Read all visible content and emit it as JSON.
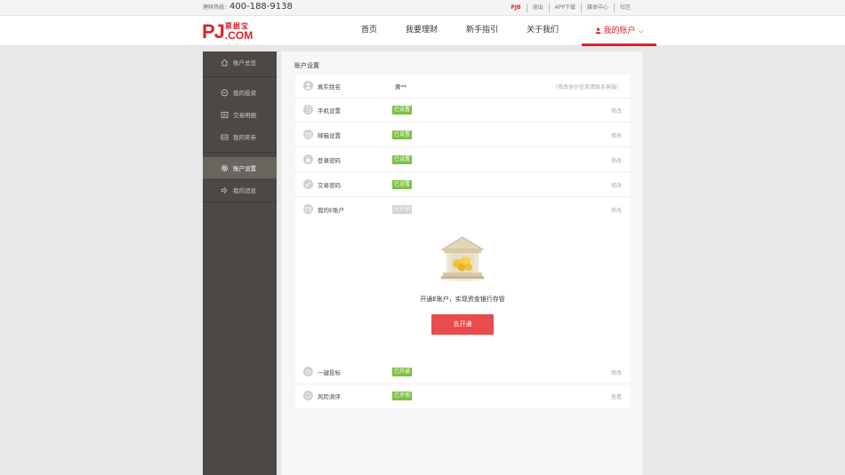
{
  "topbar": {
    "hotline_label": "理财热线：",
    "hotline_number": "400-188-9138",
    "links": [
      "PJB",
      "退出",
      "APP下载",
      "媒体中心",
      "社区"
    ]
  },
  "header": {
    "logo_main": "PJ",
    "logo_cn": "票据宝",
    "logo_com": ".COM",
    "nav": [
      {
        "label": "首页"
      },
      {
        "label": "我要理财"
      },
      {
        "label": "新手指引"
      },
      {
        "label": "关于我们"
      }
    ],
    "account_label": "我的账户",
    "accent_color": "#d9232e"
  },
  "sidebar": {
    "items": [
      {
        "label": "账户总览",
        "icon": "home-icon"
      },
      {
        "label": "我的投资",
        "icon": "invest-icon"
      },
      {
        "label": "交易明细",
        "icon": "ledger-icon"
      },
      {
        "label": "我的奖券",
        "icon": "coupon-icon"
      },
      {
        "label": "账户设置",
        "icon": "gear-icon",
        "active": true
      },
      {
        "label": "我的消息",
        "icon": "speaker-icon"
      }
    ]
  },
  "main": {
    "title": "账户设置",
    "rows": [
      {
        "label": "真实姓名",
        "value": "黄**",
        "action": "（修改身份信息请联系客服）"
      },
      {
        "label": "手机设置",
        "status": "已设置",
        "action": "修改"
      },
      {
        "label": "邮箱设置",
        "status": "已设置",
        "action": "修改"
      },
      {
        "label": "登录密码",
        "status": "已设置",
        "action": "修改"
      },
      {
        "label": "交易密码",
        "status": "已设置",
        "action": "修改"
      },
      {
        "label": "我的E账户",
        "status": "未开通",
        "action": "修改"
      }
    ],
    "promo": {
      "text": "开通E账户，实现资金银行存管",
      "button": "去开通"
    },
    "bottom_rows": [
      {
        "label": "一键投标",
        "status": "已开通",
        "action": "修改"
      },
      {
        "label": "风险测评",
        "status": "已评测",
        "action": "查看"
      }
    ]
  }
}
